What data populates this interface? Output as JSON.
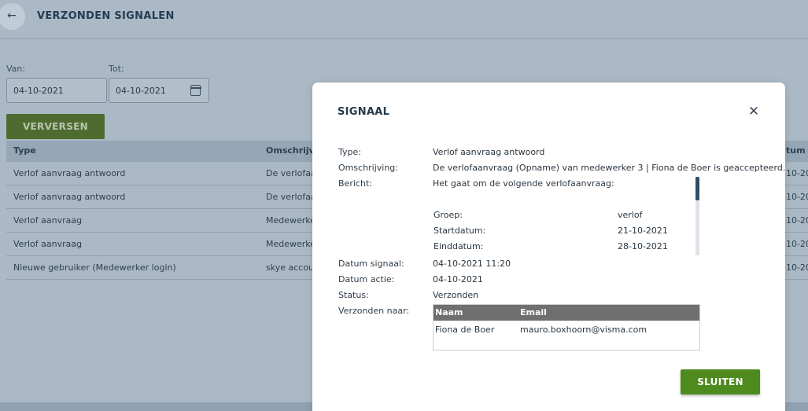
{
  "page": {
    "title": "VERZONDEN SIGNALEN",
    "back_icon": "arrow-left-icon",
    "filters": {
      "from_label": "Van:",
      "from_value": "04-10-2021",
      "to_label": "Tot:",
      "to_value": "04-10-2021",
      "calendar_icon": "calendar-icon"
    },
    "refresh_label": "VERVERSEN",
    "table": {
      "headers": [
        "Type",
        "Omschrijvi",
        "tum"
      ],
      "rows": [
        {
          "type": "Verlof aanvraag antwoord",
          "desc": "De verlofaa",
          "date": "-10-20"
        },
        {
          "type": "Verlof aanvraag antwoord",
          "desc": "De verlofaa",
          "date": "-10-20"
        },
        {
          "type": "Verlof aanvraag",
          "desc": "Medewerke",
          "date": "-10-20"
        },
        {
          "type": "Verlof aanvraag",
          "desc": "Medewerke",
          "date": "-10-20"
        },
        {
          "type": "Nieuwe gebruiker (Medewerker login)",
          "desc": "skye accour",
          "date": "-10-20"
        }
      ]
    }
  },
  "modal": {
    "title": "SIGNAAL",
    "close_icon": "close-icon",
    "fields": {
      "type_label": "Type:",
      "type_value": "Verlof aanvraag antwoord",
      "desc_label": "Omschrijving:",
      "desc_value": "De verlofaanvraag (Opname) van medewerker 3 | Fiona de Boer is geaccepteerd.",
      "message_label": "Bericht:",
      "date_signal_label": "Datum signaal:",
      "date_signal_value": "04-10-2021 11:20",
      "date_action_label": "Datum actie:",
      "date_action_value": "04-10-2021",
      "status_label": "Status:",
      "status_value": "Verzonden",
      "sent_to_label": "Verzonden naar:"
    },
    "message": {
      "intro": "Het gaat om de volgende verlofaanvraag:",
      "rows": [
        {
          "key": "Groep:",
          "value": "verlof"
        },
        {
          "key": "Startdatum:",
          "value": "21-10-2021"
        },
        {
          "key": "Einddatum:",
          "value": "28-10-2021"
        }
      ]
    },
    "recipients": {
      "headers": [
        "Naam",
        "Email"
      ],
      "rows": [
        {
          "name": "Fiona de Boer",
          "email": "mauro.boxhoorn@visma.com"
        }
      ]
    },
    "close_button_label": "SLUITEN"
  },
  "colors": {
    "primary_green": "#4e8a1e",
    "title_navy": "#27394a",
    "overlay_gray": "#aab9c5",
    "table_header_gray": "#6f6f6f"
  }
}
